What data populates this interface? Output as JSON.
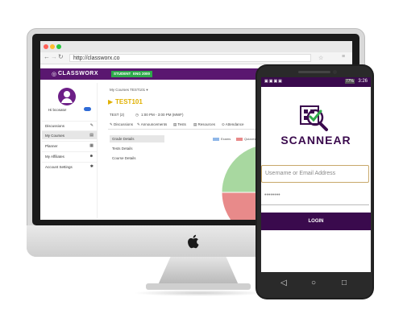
{
  "browser": {
    "url": "http://classworx.co"
  },
  "app": {
    "logo": "CLASSWORX",
    "buttons": [
      "STUDENT",
      "ENG 2000"
    ]
  },
  "sidebar": {
    "greeting": "Hi bcosato!",
    "items": [
      {
        "label": "Discussions",
        "icon": "chat-icon"
      },
      {
        "label": "My Courses",
        "icon": "book-icon",
        "active": true
      },
      {
        "label": "Planner",
        "icon": "calendar-icon"
      },
      {
        "label": "My Affiliates",
        "icon": "people-icon"
      },
      {
        "label": "Account Settings",
        "icon": "gear-icon"
      }
    ]
  },
  "main": {
    "breadcrumb": "My Courses   TEST101 ▾",
    "course_name": "TEST101",
    "meta": [
      "TEST (2)",
      "1:00 PM - 3:00 PM (MWF)"
    ],
    "tabs": [
      "Discussions",
      "Announcements",
      "Tests",
      "Resources",
      "Attendance"
    ],
    "subnav": [
      "Grade Details",
      "Tests Details",
      "Course Details"
    ],
    "legend": [
      {
        "label": "Exams",
        "color": "#8fb7e8"
      },
      {
        "label": "Quizzes",
        "color": "#e88a8a"
      },
      {
        "label": "",
        "color": "#f2c36b"
      }
    ],
    "pie": [
      {
        "color": "#a8d8a0",
        "value": 0.25
      },
      {
        "color": "#f6c37a",
        "value": 0.25
      },
      {
        "color": "#8fb7e8",
        "value": 0.25
      },
      {
        "color": "#e88a8a",
        "value": 0.25
      }
    ]
  },
  "phone": {
    "status_time": "3:26",
    "battery": "77%",
    "brand": "SCANNEAR",
    "username_placeholder": "Username or Email Address",
    "password_value": "••••••••",
    "login_label": "LOGIN",
    "colors": {
      "brand": "#3a0a4d",
      "accent": "#2eaa4a",
      "input_border": "#c8a86a"
    }
  }
}
